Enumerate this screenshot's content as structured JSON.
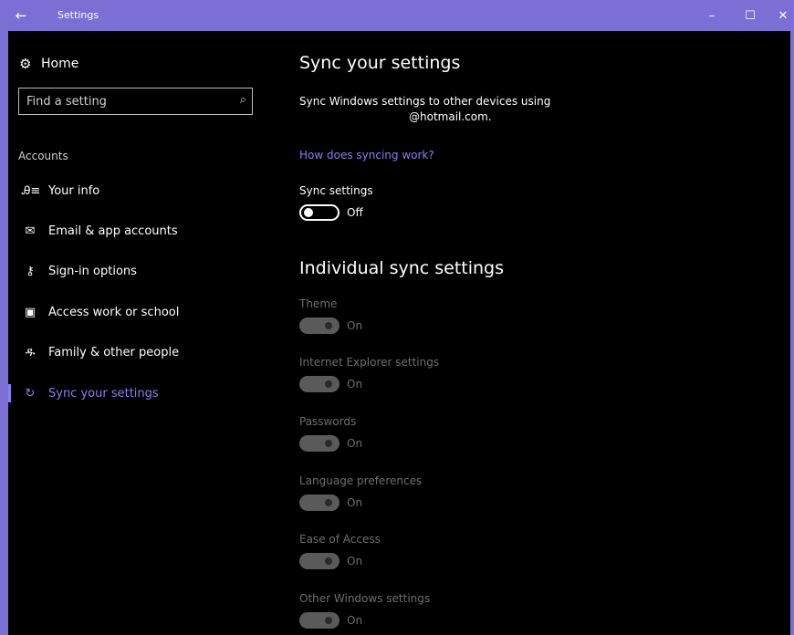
{
  "window": {
    "title": "Settings",
    "back_icon": "arrow-left-icon",
    "accent_color": "#7b6fd6",
    "controls": {
      "minimize": "–",
      "maximize": "☐",
      "close": "✕"
    }
  },
  "sidebar": {
    "home_label": "Home",
    "search_placeholder": "Find a setting",
    "section_label": "Accounts",
    "items": [
      {
        "label": "Your info",
        "icon": "person-card-icon",
        "glyph": "Ꭿ≡"
      },
      {
        "label": "Email & app accounts",
        "icon": "mail-icon",
        "glyph": "✉"
      },
      {
        "label": "Sign-in options",
        "icon": "key-icon",
        "glyph": "⚷"
      },
      {
        "label": "Access work or school",
        "icon": "briefcase-icon",
        "glyph": "▣"
      },
      {
        "label": "Family & other people",
        "icon": "people-icon",
        "glyph": "ዱ"
      },
      {
        "label": "Sync your settings",
        "icon": "sync-icon",
        "glyph": "↻",
        "active": true
      }
    ]
  },
  "main": {
    "title": "Sync your settings",
    "description_line1": "Sync Windows settings to other devices using",
    "description_line2": "@hotmail.com.",
    "link": "How does syncing work?",
    "sync_settings": {
      "label": "Sync settings",
      "state": "Off"
    },
    "individual_title": "Individual sync settings",
    "individual": [
      {
        "label": "Theme",
        "state": "On"
      },
      {
        "label": "Internet Explorer settings",
        "state": "On"
      },
      {
        "label": "Passwords",
        "state": "On"
      },
      {
        "label": "Language preferences",
        "state": "On"
      },
      {
        "label": "Ease of Access",
        "state": "On"
      },
      {
        "label": "Other Windows settings",
        "state": "On"
      }
    ]
  }
}
